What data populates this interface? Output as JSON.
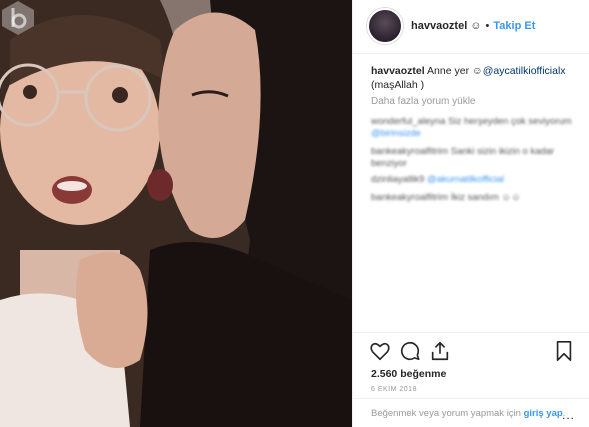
{
  "post": {
    "username": "havvaoztel",
    "username_suffix": " ☺",
    "separator": "•",
    "follow_label": "Takip Et",
    "caption_username": "havvaoztel",
    "caption_text": " Anne yer ☺",
    "caption_mention": "@aycatilkiofficialx",
    "caption_tail": " (maşAllah )",
    "load_more": "Daha fazla yorum yükle",
    "comments": [
      {
        "user": "wonderful_aleyna",
        "text": " Siz herşeyden çok seviyorum",
        "mention": "@birinsizde"
      },
      {
        "user": "bankeakyroalfitrim",
        "text": " Sanki sizin ikizin o kadar benziyor",
        "mention": ""
      },
      {
        "user": "dzinliayallik9",
        "text": " ",
        "mention": "@akurnatilkofficial"
      },
      {
        "user": "bankeakyroalfitrim",
        "text": " İkiz sandım ☺☺",
        "mention": ""
      }
    ],
    "likes": "2.560 beğenme",
    "date": "6 EKİM 2018",
    "login_prefix": "Beğenmek veya yorum yapmak için ",
    "login_link": "giriş yap",
    "login_suffix": ".",
    "more_options": "..."
  },
  "icons": {
    "like": "heart-icon",
    "comment": "comment-icon",
    "share": "share-icon",
    "save": "bookmark-icon",
    "watermark": "b-logo-watermark"
  }
}
